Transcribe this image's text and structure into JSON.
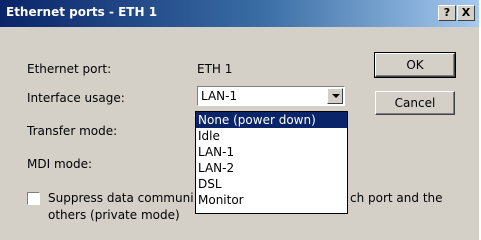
{
  "window": {
    "title": "Ethernet ports - ETH 1",
    "help_label": "?",
    "close_label": "X"
  },
  "fields": {
    "ethernet_port_label": "Ethernet port:",
    "ethernet_port_value": "ETH 1",
    "interface_usage_label": "Interface usage:",
    "interface_usage_value": "LAN-1",
    "transfer_mode_label": "Transfer mode:",
    "mdi_mode_label": "MDI mode:"
  },
  "dropdown": {
    "options": [
      "None (power down)",
      "Idle",
      "LAN-1",
      "LAN-2",
      "DSL",
      "Monitor"
    ],
    "highlighted_index": 0
  },
  "checkbox": {
    "line1_left": "Suppress data communi",
    "line1_right": "ch port and the",
    "line2": "others (private mode)",
    "checked": false
  },
  "buttons": {
    "ok": "OK",
    "cancel": "Cancel"
  },
  "colors": {
    "titlebar_start": "#0a246a",
    "titlebar_end": "#a6caf0",
    "dialog_bg": "#d4d0c8",
    "selection": "#0a246a"
  }
}
